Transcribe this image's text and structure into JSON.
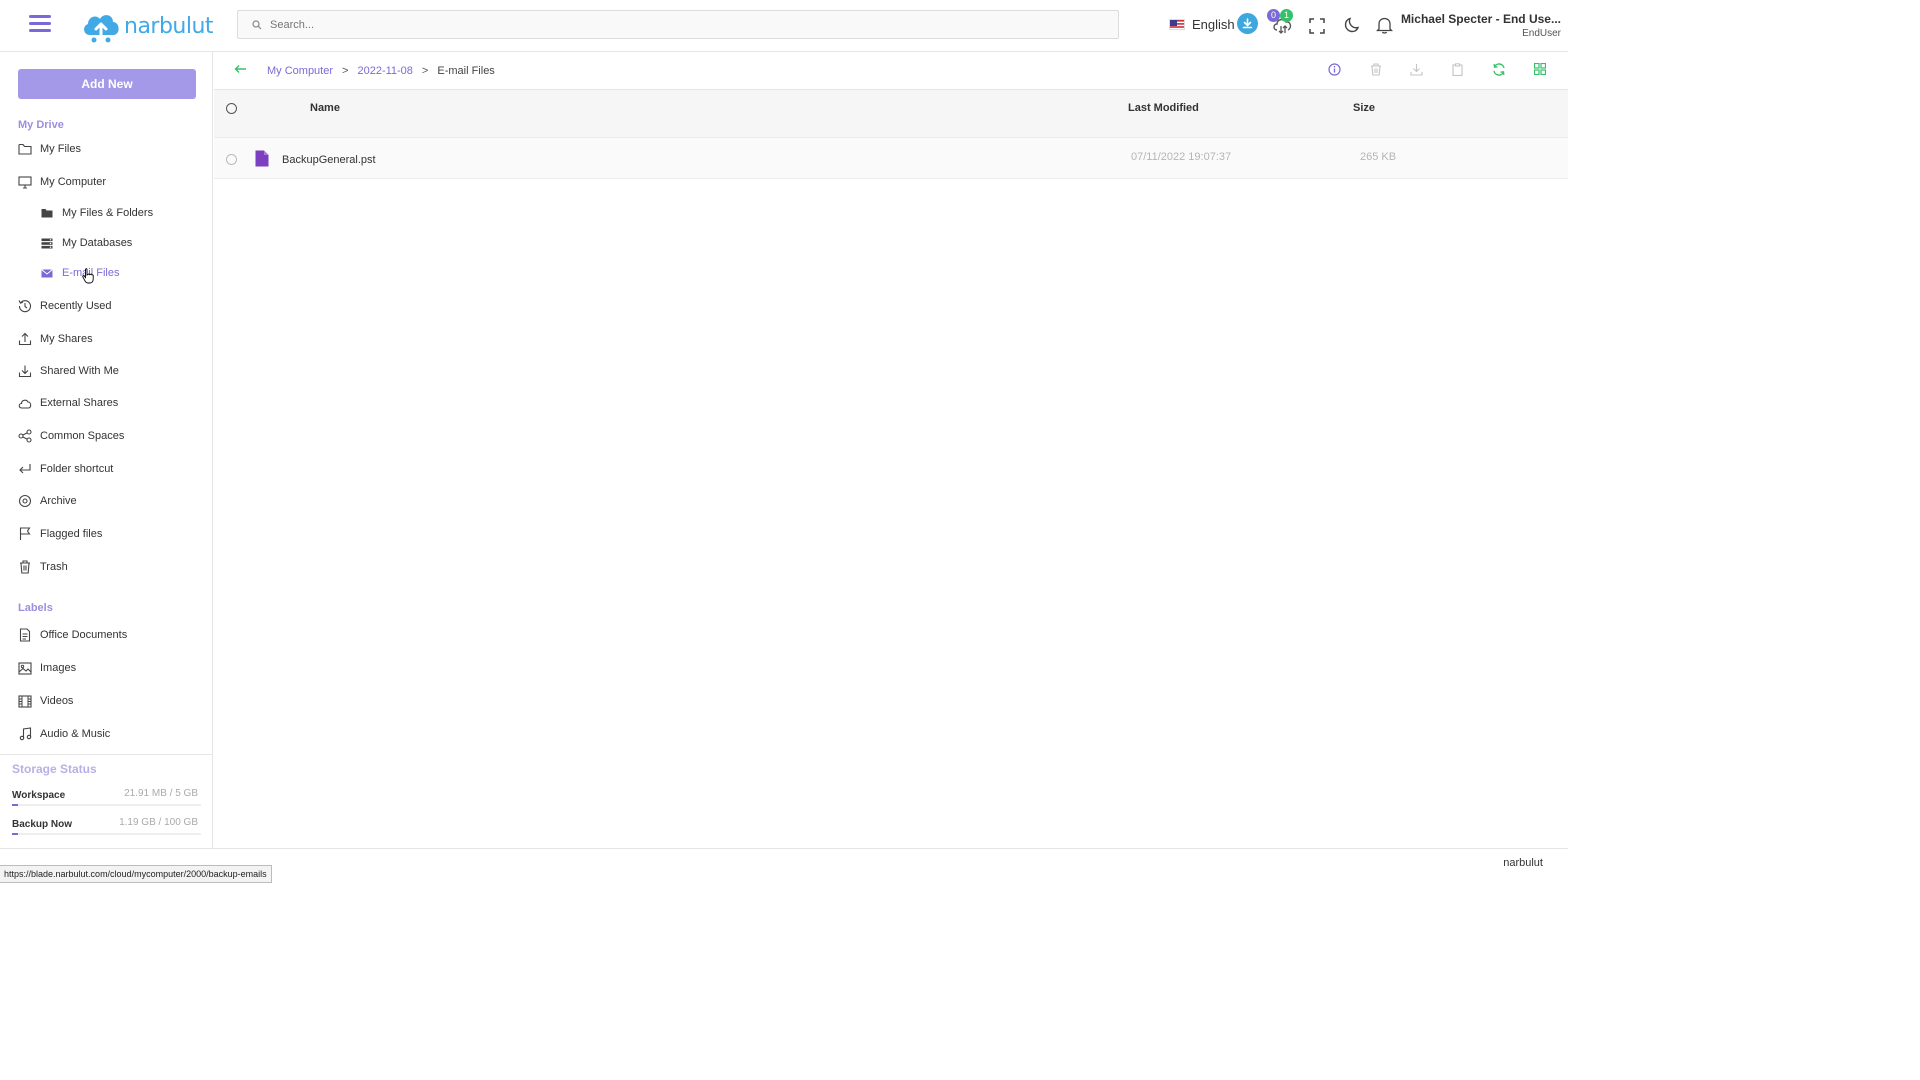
{
  "topbar": {
    "logo_text": "narbulut",
    "search_placeholder": "Search...",
    "language": "English",
    "badge_purple": "0",
    "badge_green": "1",
    "user_name": "Michael Specter - End Use...",
    "user_role": "EndUser"
  },
  "sidebar": {
    "add_new_label": "Add New",
    "my_drive_title": "My Drive",
    "items": {
      "my_files": "My Files",
      "my_computer": "My Computer",
      "files_folders": "My Files & Folders",
      "databases": "My Databases",
      "email_files": "E-mail Files",
      "recently_used": "Recently Used",
      "my_shares": "My Shares",
      "shared_with_me": "Shared With Me",
      "external_shares": "External Shares",
      "common_spaces": "Common Spaces",
      "folder_shortcut": "Folder shortcut",
      "archive": "Archive",
      "flagged_files": "Flagged files",
      "trash": "Trash"
    },
    "labels_title": "Labels",
    "labels": {
      "office": "Office Documents",
      "images": "Images",
      "videos": "Videos",
      "audio": "Audio & Music"
    },
    "storage": {
      "title": "Storage Status",
      "workspace_label": "Workspace",
      "workspace_value": "21.91 MB / 5 GB",
      "workspace_fraction": 0.004,
      "backup_label": "Backup Now",
      "backup_value": "1.19 GB / 100 GB",
      "backup_fraction": 0.012
    }
  },
  "breadcrumb": {
    "root": "My Computer",
    "date": "2022-11-08",
    "current": "E-mail Files"
  },
  "table": {
    "col_name": "Name",
    "col_modified": "Last Modified",
    "col_size": "Size",
    "rows": [
      {
        "name": "BackupGeneral.pst",
        "modified": "07/11/2022 19:07:37",
        "size": "265 KB"
      }
    ]
  },
  "footer": {
    "brand": "narbulut",
    "status_url": "https://blade.narbulut.com/cloud/mycomputer/2000/backup-emails"
  },
  "colors": {
    "accent": "#7b6ad6",
    "accent_light": "#a498e8",
    "brand_blue": "#40a9e6",
    "success": "#36c169"
  }
}
